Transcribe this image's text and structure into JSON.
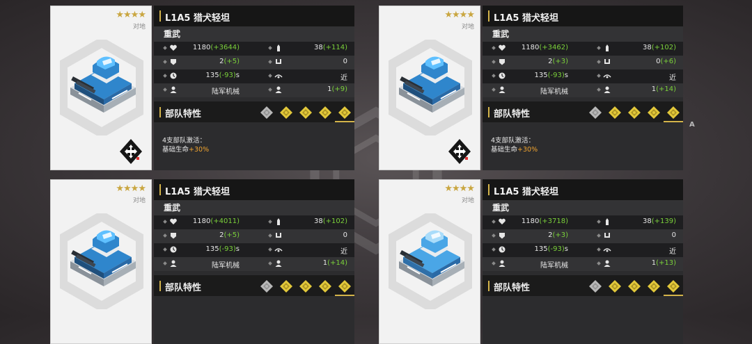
{
  "side_letter": "A",
  "cards": [
    {
      "stars": "★★★★",
      "role": "对地",
      "name": "L1A5 猎犬轻坦",
      "type": "重武",
      "stats": {
        "hp": {
          "base": "1180",
          "bonus": "(+3644)"
        },
        "ammo": {
          "base": "38",
          "bonus": "(+114)"
        },
        "armor": {
          "base": "2",
          "bonus": "(+5)"
        },
        "pierce": {
          "base": "0",
          "bonus": ""
        },
        "speed": {
          "base": "135",
          "bonus": "(-93)",
          "unit": "s"
        },
        "range": {
          "base": "近",
          "bonus": ""
        },
        "category": {
          "base": "陆军机械",
          "bonus": ""
        },
        "supply": {
          "base": "1",
          "bonus": "(+9)"
        }
      },
      "traits_label": "部队特性",
      "effect_line1": "4支部队激活：",
      "effect_prefix": "基础生命",
      "effect_value": "+30%",
      "has_class_icon": true,
      "tank_light": false
    },
    {
      "stars": "★★★★",
      "role": "对地",
      "name": "L1A5 猎犬轻坦",
      "type": "重武",
      "stats": {
        "hp": {
          "base": "1180",
          "bonus": "(+3462)"
        },
        "ammo": {
          "base": "38",
          "bonus": "(+102)"
        },
        "armor": {
          "base": "2",
          "bonus": "(+3)"
        },
        "pierce": {
          "base": "0",
          "bonus": "(+6)"
        },
        "speed": {
          "base": "135",
          "bonus": "(-93)",
          "unit": "s"
        },
        "range": {
          "base": "近",
          "bonus": ""
        },
        "category": {
          "base": "陆军机械",
          "bonus": ""
        },
        "supply": {
          "base": "1",
          "bonus": "(+14)"
        }
      },
      "traits_label": "部队特性",
      "effect_line1": "4支部队激活：",
      "effect_prefix": "基础生命",
      "effect_value": "+30%",
      "has_class_icon": true,
      "tank_light": false
    },
    {
      "stars": "★★★★",
      "role": "对地",
      "name": "L1A5 猎犬轻坦",
      "type": "重武",
      "stats": {
        "hp": {
          "base": "1180",
          "bonus": "(+4011)"
        },
        "ammo": {
          "base": "38",
          "bonus": "(+102)"
        },
        "armor": {
          "base": "2",
          "bonus": "(+5)"
        },
        "pierce": {
          "base": "0",
          "bonus": ""
        },
        "speed": {
          "base": "135",
          "bonus": "(-93)",
          "unit": "s"
        },
        "range": {
          "base": "近",
          "bonus": ""
        },
        "category": {
          "base": "陆军机械",
          "bonus": ""
        },
        "supply": {
          "base": "1",
          "bonus": "(+14)"
        }
      },
      "traits_label": "部队特性",
      "effect_line1": "",
      "effect_prefix": "",
      "effect_value": "",
      "has_class_icon": false,
      "tank_light": false
    },
    {
      "stars": "★★★★",
      "role": "对地",
      "name": "L1A5 猎犬轻坦",
      "type": "重武",
      "stats": {
        "hp": {
          "base": "1180",
          "bonus": "(+3718)"
        },
        "ammo": {
          "base": "38",
          "bonus": "(+139)"
        },
        "armor": {
          "base": "2",
          "bonus": "(+3)"
        },
        "pierce": {
          "base": "0",
          "bonus": ""
        },
        "speed": {
          "base": "135",
          "bonus": "(-93)",
          "unit": "s"
        },
        "range": {
          "base": "近",
          "bonus": ""
        },
        "category": {
          "base": "陆军机械",
          "bonus": ""
        },
        "supply": {
          "base": "1",
          "bonus": "(+13)"
        }
      },
      "traits_label": "部队特性",
      "effect_line1": "",
      "effect_prefix": "",
      "effect_value": "",
      "has_class_icon": false,
      "tank_light": true
    }
  ],
  "trait_icons": [
    "diamond-grey",
    "diamond-yellow",
    "diamond-yellow",
    "diamond-yellow",
    "diamond-yellow-active"
  ],
  "colors": {
    "accent": "#d4b44a",
    "bonus": "#7bd13a",
    "effect": "#f0a430",
    "tank_blue": "#2f8fd6"
  }
}
